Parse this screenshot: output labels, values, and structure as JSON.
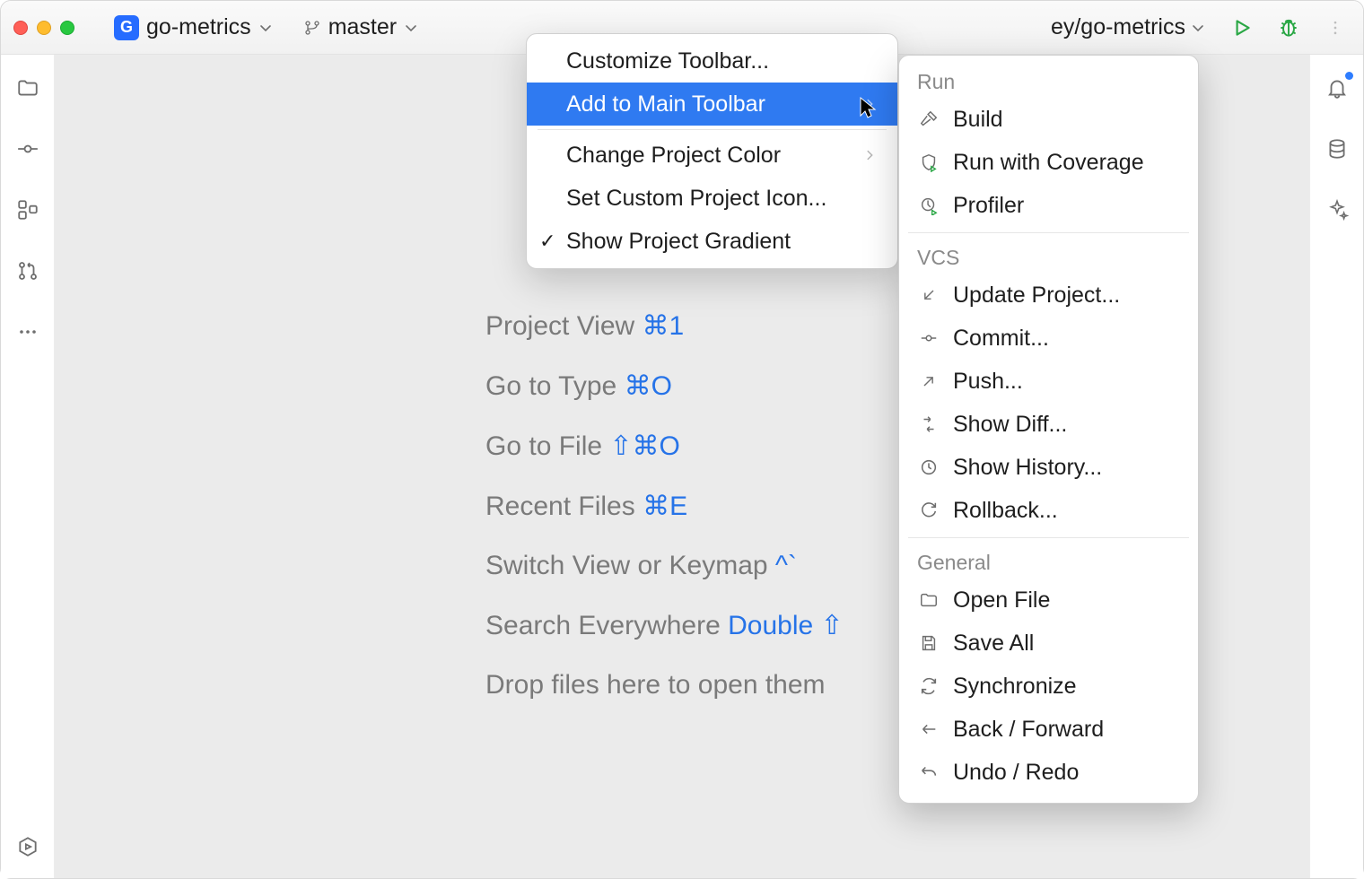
{
  "titlebar": {
    "project_icon_letter": "G",
    "project_name": "go-metrics",
    "branch": "master",
    "path_suffix": "ey/go-metrics"
  },
  "left_strip": {
    "items": [
      "folder",
      "commit",
      "structure",
      "pull-requests",
      "more",
      "services"
    ]
  },
  "right_strip": {
    "items": [
      "notifications",
      "database",
      "ai"
    ]
  },
  "shortcuts": [
    {
      "label": "Project View",
      "kbd": "⌘1"
    },
    {
      "label": "Go to Type",
      "kbd": "⌘O"
    },
    {
      "label": "Go to File",
      "kbd": "⇧⌘O"
    },
    {
      "label": "Recent Files",
      "kbd": "⌘E"
    },
    {
      "label": "Switch View or Keymap",
      "kbd": "^`"
    },
    {
      "label": "Search Everywhere",
      "kbd": "Double ⇧"
    },
    {
      "label": "Drop files here to open them",
      "kbd": ""
    }
  ],
  "context_menu": {
    "items": [
      {
        "label": "Customize Toolbar...",
        "selected": false,
        "submenu": false,
        "checked": false
      },
      {
        "label": "Add to Main Toolbar",
        "selected": true,
        "submenu": true,
        "checked": false
      },
      {
        "sep": true
      },
      {
        "label": "Change Project Color",
        "selected": false,
        "submenu": true,
        "checked": false
      },
      {
        "label": "Set Custom Project Icon...",
        "selected": false,
        "submenu": false,
        "checked": false
      },
      {
        "label": "Show Project Gradient",
        "selected": false,
        "submenu": false,
        "checked": true
      }
    ]
  },
  "submenu": {
    "sections": [
      {
        "header": "Run",
        "items": [
          {
            "icon": "hammer",
            "label": "Build"
          },
          {
            "icon": "shield-play",
            "label": "Run with Coverage"
          },
          {
            "icon": "profiler",
            "label": "Profiler"
          }
        ]
      },
      {
        "header": "VCS",
        "items": [
          {
            "icon": "arrow-in",
            "label": "Update Project..."
          },
          {
            "icon": "commit",
            "label": "Commit..."
          },
          {
            "icon": "arrow-out",
            "label": "Push..."
          },
          {
            "icon": "diff",
            "label": "Show Diff..."
          },
          {
            "icon": "clock",
            "label": "Show History..."
          },
          {
            "icon": "rollback",
            "label": "Rollback..."
          }
        ]
      },
      {
        "header": "General",
        "items": [
          {
            "icon": "folder",
            "label": "Open File"
          },
          {
            "icon": "save",
            "label": "Save All"
          },
          {
            "icon": "sync",
            "label": "Synchronize"
          },
          {
            "icon": "back-forward",
            "label": "Back / Forward"
          },
          {
            "icon": "undo",
            "label": "Undo / Redo"
          }
        ]
      }
    ]
  }
}
